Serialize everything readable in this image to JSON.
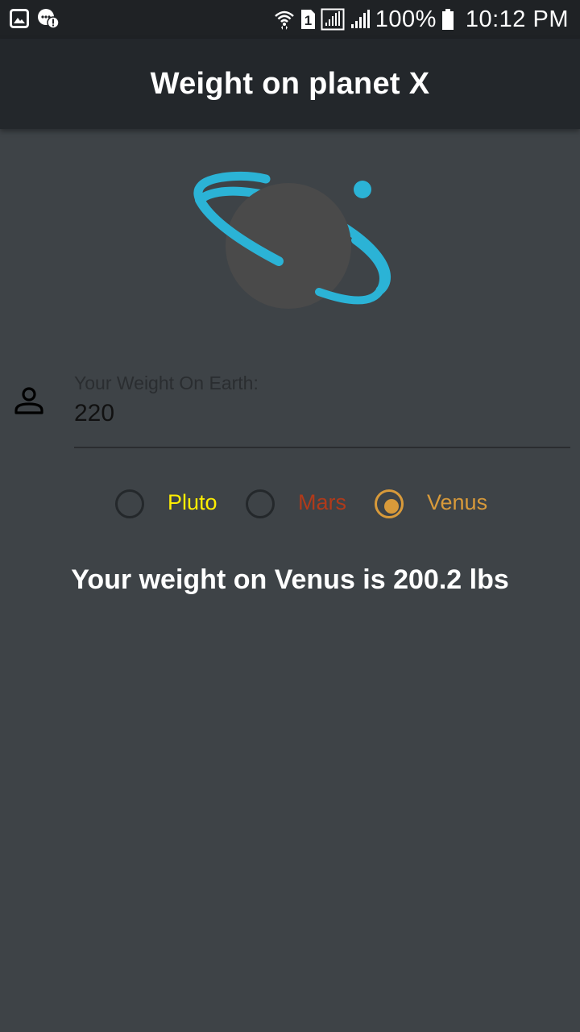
{
  "status_bar": {
    "battery": "100%",
    "time": "10:12 PM",
    "sim_slot": "1",
    "icons": [
      "gallery-icon",
      "alert-chat-icon",
      "wifi-icon",
      "sim-icon",
      "signal-icon",
      "signal-icon",
      "battery-icon"
    ]
  },
  "app_bar": {
    "title": "Weight on planet X"
  },
  "logo": {
    "ring_color": "#2bb3d6",
    "planet_color": "#4a4a4a"
  },
  "weight_input": {
    "label": "Your Weight On Earth:",
    "value": "220",
    "icon": "person-icon"
  },
  "planets": {
    "options": [
      {
        "label": "Pluto",
        "color": "#ffee00",
        "selected": false
      },
      {
        "label": "Mars",
        "color": "#b03a1a",
        "selected": false
      },
      {
        "label": "Venus",
        "color": "#d89a3a",
        "selected": true
      }
    ]
  },
  "result": {
    "text": "Your weight on Venus is 200.2 lbs"
  }
}
